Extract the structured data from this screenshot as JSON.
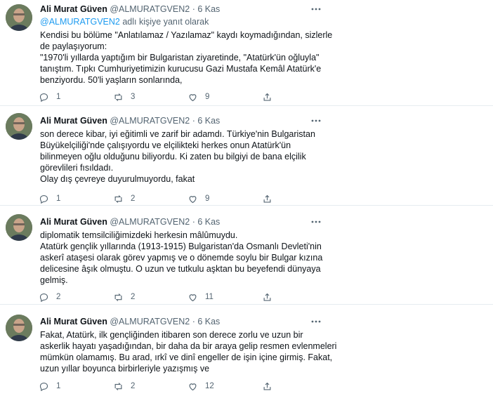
{
  "tweets": [
    {
      "author": "Ali Murat Güven",
      "handle": "@ALMURATGVEN2",
      "dot": "·",
      "date": "6 Kas",
      "reply_to": {
        "mention": "@ALMURATGVEN2",
        "suffix": " adlı kişiye yanıt olarak"
      },
      "lines": [
        "Kendisi bu bölüme \"Anlatılamaz / Yazılamaz\" kaydı koymadığından, sizlerle",
        "de paylaşıyorum:",
        "\"1970'li yıllarda yaptığım bir Bulgaristan ziyaretinde, \"Atatürk'ün oğluyla\"",
        "tanıştım. Tıpkı Cumhuriyetimizin kurucusu Gazi Mustafa Kemâl Atatürk'e",
        "benziyordu. 50'li yaşların sonlarında,"
      ],
      "replies": "1",
      "retweets": "3",
      "likes": "9"
    },
    {
      "author": "Ali Murat Güven",
      "handle": "@ALMURATGVEN2",
      "dot": "·",
      "date": "6 Kas",
      "lines": [
        "son derece kibar, iyi eğitimli ve zarif bir adamdı. Türkiye'nin Bulgaristan",
        "Büyükelçiliği'nde çalışıyordu ve elçilikteki herkes onun Atatürk'ün",
        "bilinmeyen oğlu olduğunu biliyordu. Ki zaten bu bilgiyi de bana elçilik",
        "görevlileri fısıldadı.",
        "Olay dış çevreye duyurulmuyordu, fakat"
      ],
      "replies": "1",
      "retweets": "2",
      "likes": "9"
    },
    {
      "author": "Ali Murat Güven",
      "handle": "@ALMURATGVEN2",
      "dot": "·",
      "date": "6 Kas",
      "lines": [
        "diplomatik temsilciliğimizdeki herkesin mâlûmuydu.",
        "Atatürk gençlik yıllarında (1913-1915) Bulgaristan'da Osmanlı Devleti'nin",
        "askerî ataşesi olarak görev yapmış ve o dönemde soylu bir Bulgar kızına",
        "delicesine âşık olmuştu. O uzun ve tutkulu aşktan bu beyefendi dünyaya",
        "gelmiş."
      ],
      "replies": "2",
      "retweets": "2",
      "likes": "11"
    },
    {
      "author": "Ali Murat Güven",
      "handle": "@ALMURATGVEN2",
      "dot": "·",
      "date": "6 Kas",
      "lines": [
        "Fakat, Atatürk, ilk gençliğinden itibaren son derece zorlu ve uzun bir",
        "askerlik hayatı yaşadığından, bir daha da bir araya gelip resmen evlenmeleri",
        "mümkün olamamış. Bu arad, ırkî ve dinî engeller de işin içine girmiş. Fakat,",
        "uzun yıllar boyunca birbirleriyle yazışmış ve"
      ],
      "replies": "1",
      "retweets": "2",
      "likes": "12"
    }
  ],
  "colors": {
    "text": "#0f1419",
    "secondary": "#536471",
    "link": "#1d9bf0",
    "divider": "#e6ecf0"
  },
  "icons": {
    "reply": "reply-icon",
    "retweet": "retweet-icon",
    "like": "like-icon",
    "share": "share-icon",
    "more": "more-icon"
  }
}
